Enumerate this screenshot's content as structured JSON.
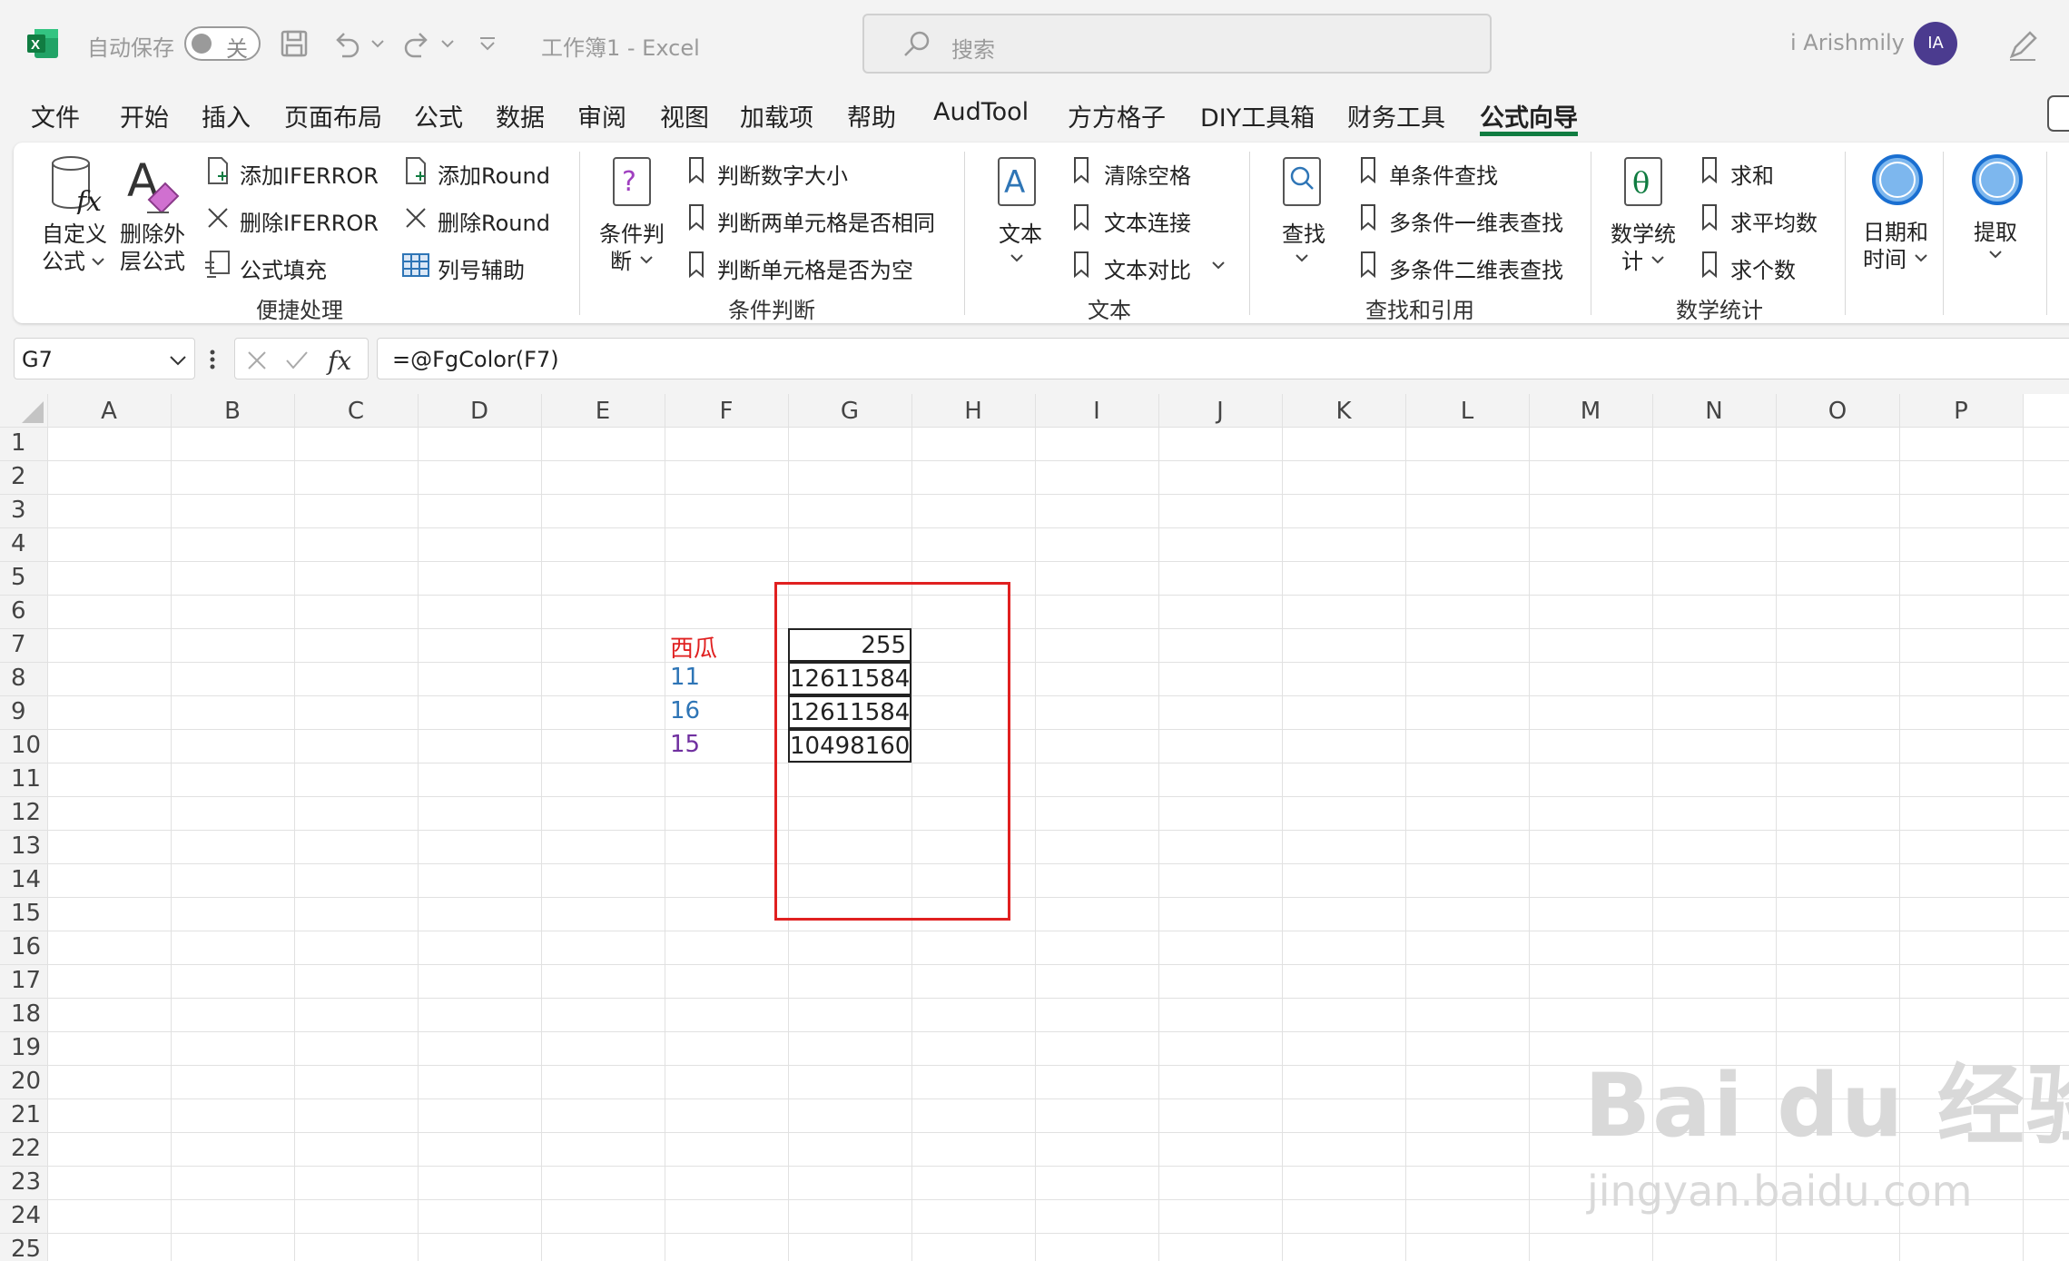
{
  "titlebar": {
    "autosave_label": "自动保存",
    "autosave_state": "关",
    "doc_title": "工作簿1  -  Excel",
    "search_placeholder": "搜索",
    "user_name": "i Arishmily",
    "avatar_initials": "IA"
  },
  "menu": {
    "tabs": [
      "文件",
      "开始",
      "插入",
      "页面布局",
      "公式",
      "数据",
      "审阅",
      "视图",
      "加载项",
      "帮助",
      "AudTool",
      "方方格子",
      "DIY工具箱",
      "财务工具",
      "公式向导"
    ],
    "active": "公式向导"
  },
  "ribbon": {
    "g1": {
      "custom_formula": [
        "自定义",
        "公式"
      ],
      "remove_outer": [
        "删除外",
        "层公式"
      ],
      "add_iferror": "添加IFERROR",
      "del_iferror": "删除IFERROR",
      "formula_fill": "公式填充",
      "add_round": "添加Round",
      "del_round": "删除Round",
      "col_helper": "列号辅助",
      "label": "便捷处理"
    },
    "g2": {
      "cond": [
        "条件判",
        "断"
      ],
      "item1": "判断数字大小",
      "item2": "判断两单元格是否相同",
      "item3": "判断单元格是否为空",
      "label": "条件判断"
    },
    "g3": {
      "text": "文本",
      "item1": "清除空格",
      "item2": "文本连接",
      "item3": "文本对比",
      "label": "文本"
    },
    "g4": {
      "find": "查找",
      "item1": "单条件查找",
      "item2": "多条件一维表查找",
      "item3": "多条件二维表查找",
      "label": "查找和引用"
    },
    "g5": {
      "math": [
        "数学统",
        "计"
      ],
      "item1": "求和",
      "item2": "求平均数",
      "item3": "求个数",
      "label": "数学统计"
    },
    "g6": {
      "date": [
        "日期和",
        "时间"
      ],
      "extract": "提取"
    }
  },
  "formula_bar": {
    "name_box": "G7",
    "formula": "=@FgColor(F7)"
  },
  "grid": {
    "columns": [
      "A",
      "B",
      "C",
      "D",
      "E",
      "F",
      "G",
      "H",
      "I",
      "J",
      "K",
      "L",
      "M",
      "N",
      "O",
      "P"
    ],
    "rows": [
      "1",
      "2",
      "3",
      "4",
      "5",
      "6",
      "7",
      "8",
      "9",
      "10",
      "11",
      "12",
      "13",
      "14",
      "15",
      "16",
      "17",
      "18",
      "19",
      "20",
      "21",
      "22",
      "23",
      "24",
      "25"
    ],
    "f_cells": [
      {
        "row": "7",
        "value": "西瓜",
        "color": "#e02020"
      },
      {
        "row": "8",
        "value": "11",
        "color": "#2e75b6"
      },
      {
        "row": "9",
        "value": "16",
        "color": "#2e75b6"
      },
      {
        "row": "10",
        "value": "15",
        "color": "#7030a0"
      }
    ],
    "g_cells": [
      "255",
      "12611584",
      "12611584",
      "10498160"
    ]
  },
  "watermark": {
    "main": "Bai du 经验",
    "sub": "jingyan.baidu.com"
  }
}
